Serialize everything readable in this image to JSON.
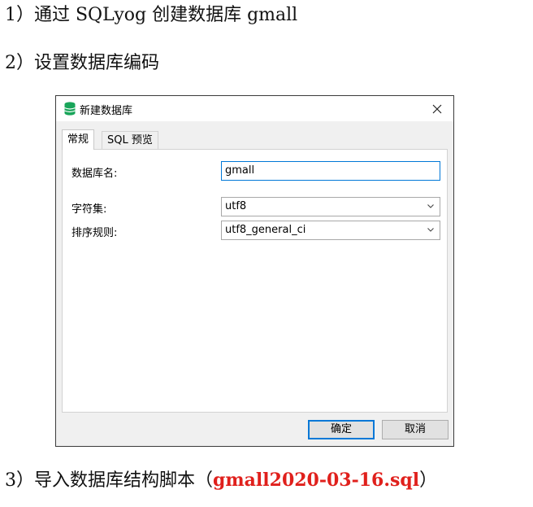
{
  "steps": {
    "step1": "1）通过 SQLyog 创建数据库 gmall",
    "step2": "2）设置数据库编码",
    "step3_prefix": "3）导入数据库结构脚本（",
    "step3_highlight": "gmall2020-03-16.sql",
    "step3_suffix": "）"
  },
  "dialog": {
    "title": "新建数据库",
    "close_glyph": "✕",
    "tabs": [
      "常规",
      "SQL 预览"
    ],
    "active_tab": "常规",
    "fields": {
      "db_name_label": "数据库名:",
      "db_name_value": "gmall",
      "charset_label": "字符集:",
      "charset_value": "utf8",
      "collation_label": "排序规则:",
      "collation_value": "utf8_general_ci"
    },
    "ok_label": "确定",
    "cancel_label": "取消"
  },
  "colors": {
    "highlight_text": "#e0201c",
    "focus_border": "#0078d7",
    "app_icon": "#19a55a"
  },
  "icons": [
    "database-icon",
    "close-icon",
    "chevron-down-icon"
  ]
}
